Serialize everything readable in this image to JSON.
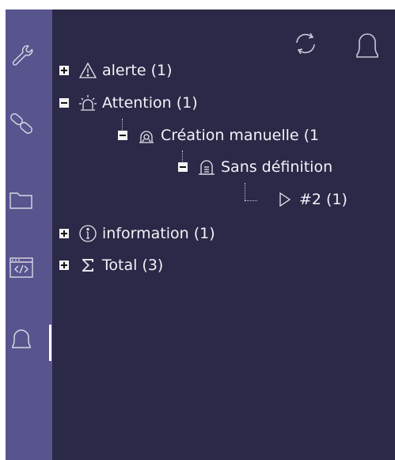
{
  "sidebar": {
    "items": [
      {
        "icon": "wrench-icon"
      },
      {
        "icon": "link-icon"
      },
      {
        "icon": "folder-icon"
      },
      {
        "icon": "code-window-icon"
      },
      {
        "icon": "bell-icon",
        "active": true
      }
    ]
  },
  "toolbar": {
    "icons": [
      "refresh-icon",
      "bell-icon"
    ]
  },
  "tree": {
    "alerte": "alerte (1)",
    "attention": "Attention (1)",
    "creation": "Création manuelle (1",
    "sans_definition": "Sans définition",
    "item2": "#2 (1)",
    "information": "information (1)",
    "total": "Total (3)"
  },
  "colors": {
    "background": "#2a2947",
    "sidebar": "#58548e",
    "text": "#f2f2f8"
  }
}
